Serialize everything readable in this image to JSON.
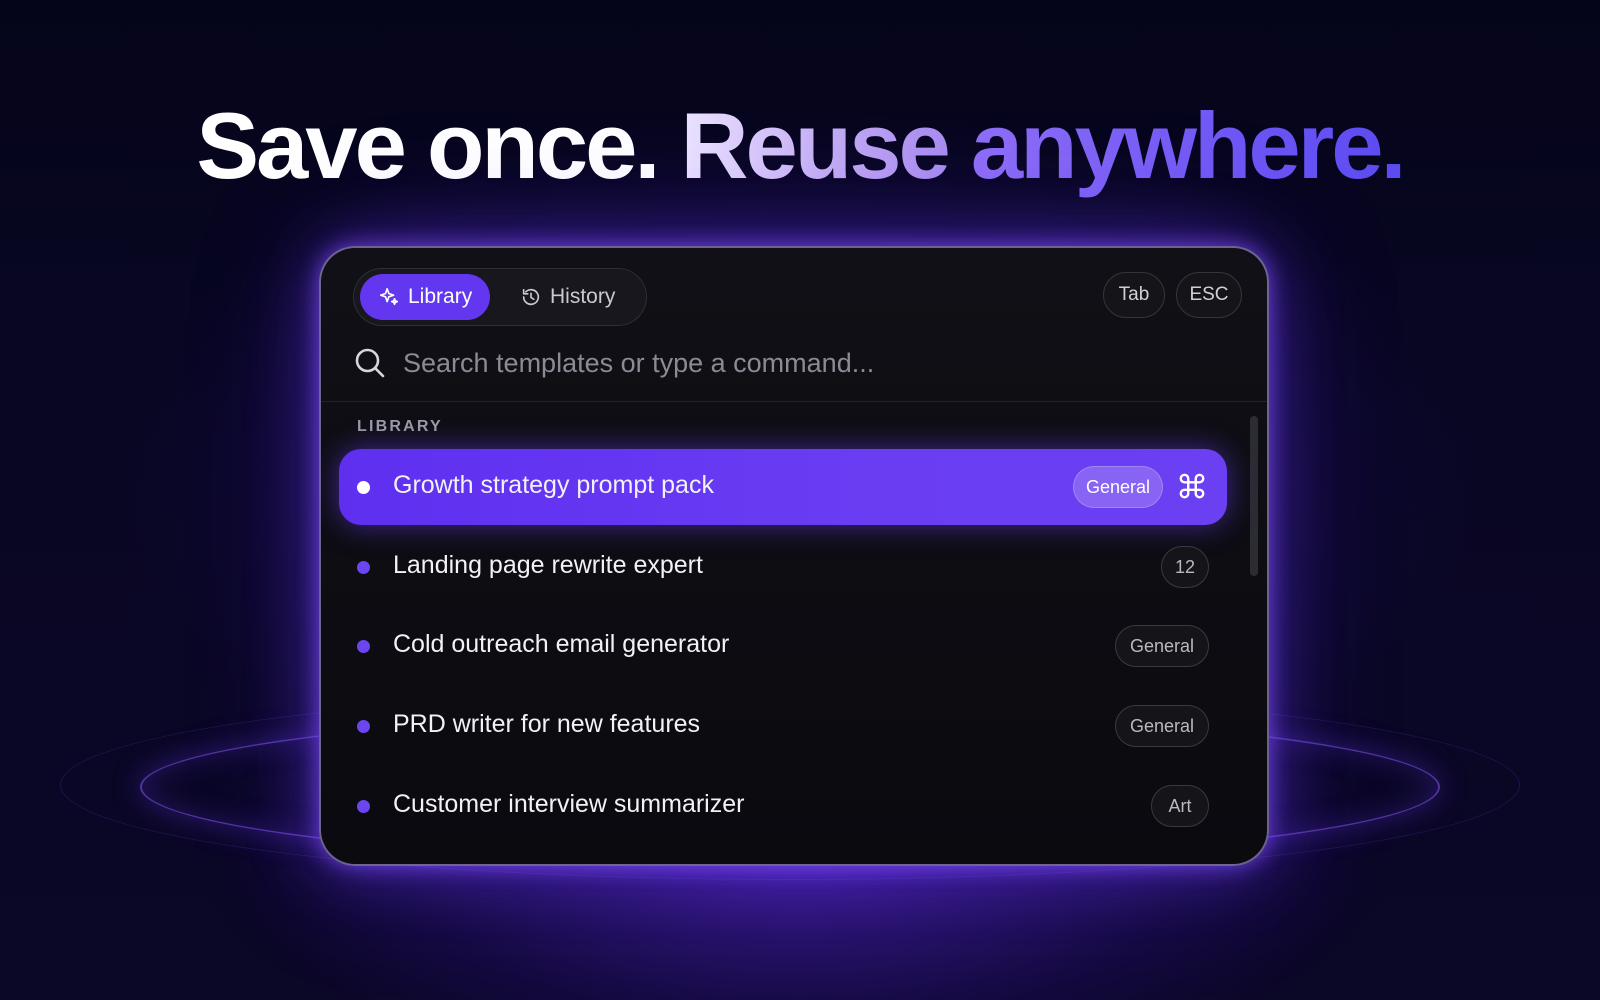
{
  "headline": {
    "part1": "Save once.",
    "part2": "Reuse",
    "part3": "anywhere."
  },
  "tabs": [
    {
      "label": "Library",
      "icon": "sparkle-icon",
      "active": true
    },
    {
      "label": "History",
      "icon": "history-icon",
      "active": false
    }
  ],
  "shortcuts": {
    "tab": "Tab",
    "esc": "ESC"
  },
  "search": {
    "placeholder": "Search templates or type a command...",
    "value": "",
    "icon": "search-icon"
  },
  "section_label": "LIBRARY",
  "items": [
    {
      "label": "Growth strategy prompt pack",
      "badge": "General",
      "selected": true,
      "shortcut_icon": "command-icon"
    },
    {
      "label": "Landing page rewrite expert",
      "badge": "12",
      "selected": false
    },
    {
      "label": "Cold outreach email generator",
      "badge": "General",
      "selected": false
    },
    {
      "label": "PRD writer for new features",
      "badge": "General",
      "selected": false
    },
    {
      "label": "Customer interview summarizer",
      "badge": "Art",
      "selected": false
    }
  ],
  "colors": {
    "accent": "#6336f0",
    "accent_dot": "#6c45f2",
    "background": "#090624",
    "panel": "#0c0c11"
  }
}
